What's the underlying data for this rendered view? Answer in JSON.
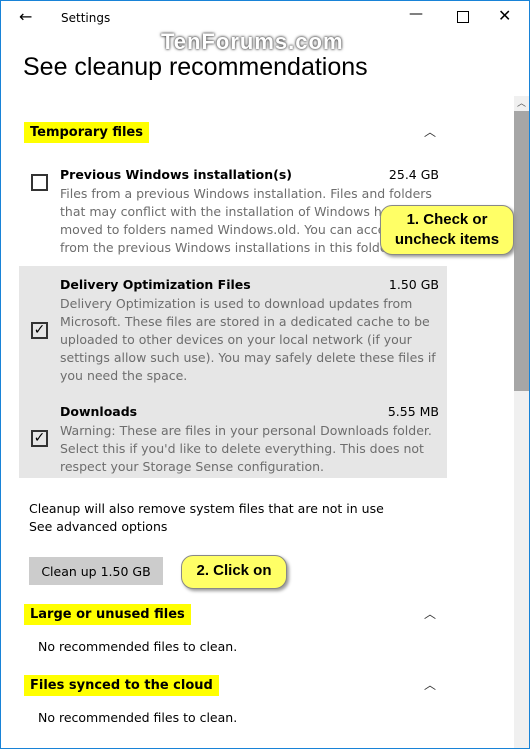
{
  "window": {
    "title": "Settings"
  },
  "watermark": "TenForums.com",
  "page_title": "See cleanup recommendations",
  "sections": {
    "temp": {
      "label": "Temporary files",
      "items": [
        {
          "title": "Previous Windows installation(s)",
          "size": "25.4 GB",
          "checked": false,
          "desc": "Files from a previous Windows installation.  Files and folders that may conflict with the installation of Windows have been moved to folders named Windows.old.  You can access data from the previous Windows installations in this folder."
        },
        {
          "title": "Delivery Optimization Files",
          "size": "1.50 GB",
          "checked": true,
          "desc": "Delivery Optimization is used to download updates from Microsoft. These files are stored in a dedicated cache to be uploaded to other devices on your local network (if your settings allow such use). You may safely delete these files if you need the space."
        },
        {
          "title": "Downloads",
          "size": "5.55 MB",
          "checked": true,
          "desc": "Warning: These are files in your personal Downloads folder. Select this if you'd like to delete everything. This does not respect your Storage Sense configuration."
        }
      ]
    },
    "large": {
      "label": "Large or unused files",
      "empty": "No recommended files to clean."
    },
    "cloud": {
      "label": "Files synced to the cloud",
      "empty": "No recommended files to clean."
    }
  },
  "cleanup_note": "Cleanup will also remove system files that are not in use",
  "advanced_link": "See advanced options",
  "cleanup_button": "Clean up 1.50 GB",
  "callouts": {
    "one": "1. Check or uncheck items",
    "two": "2. Click on"
  },
  "check_glyph": "✓"
}
